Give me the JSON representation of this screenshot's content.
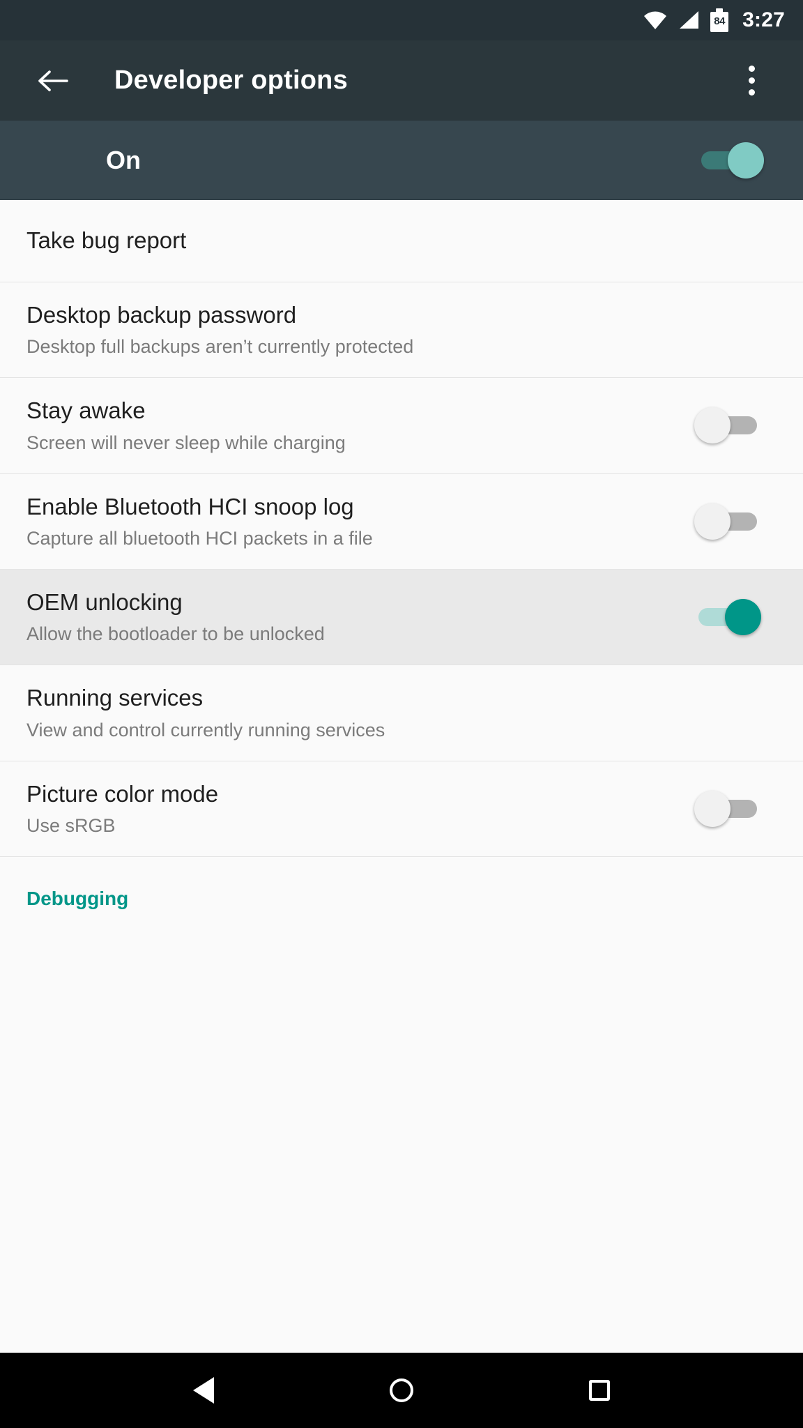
{
  "status_bar": {
    "wifi_icon": "wifi-icon",
    "signal_icon": "cell-signal-icon",
    "battery_icon": "battery-icon",
    "battery_level": "84",
    "time": "3:27"
  },
  "app_bar": {
    "back_icon": "back-arrow-icon",
    "title": "Developer options",
    "overflow_icon": "overflow-menu-icon"
  },
  "master_switch": {
    "label": "On",
    "state": "on"
  },
  "colors": {
    "accent": "#009688",
    "switch_thumb_on": "#80cbc4",
    "appbar_bg": "#2b373c",
    "band_bg": "#37474f",
    "statusbar_bg": "#263238",
    "list_bg": "#fafafa",
    "highlight_bg": "#e9e9e9"
  },
  "list": [
    {
      "title": "Take bug report",
      "subtitle": "",
      "has_switch": false,
      "switch_state": "",
      "highlighted": false
    },
    {
      "title": "Desktop backup password",
      "subtitle": "Desktop full backups aren’t currently protected",
      "has_switch": false,
      "switch_state": "",
      "highlighted": false
    },
    {
      "title": "Stay awake",
      "subtitle": "Screen will never sleep while charging",
      "has_switch": true,
      "switch_state": "off",
      "highlighted": false
    },
    {
      "title": "Enable Bluetooth HCI snoop log",
      "subtitle": "Capture all bluetooth HCI packets in a file",
      "has_switch": true,
      "switch_state": "off",
      "highlighted": false
    },
    {
      "title": "OEM unlocking",
      "subtitle": "Allow the bootloader to be unlocked",
      "has_switch": true,
      "switch_state": "on",
      "highlighted": true
    },
    {
      "title": "Running services",
      "subtitle": "View and control currently running services",
      "has_switch": false,
      "switch_state": "",
      "highlighted": false
    },
    {
      "title": "Picture color mode",
      "subtitle": "Use sRGB",
      "has_switch": true,
      "switch_state": "off",
      "highlighted": false
    }
  ],
  "section_header": {
    "label": "Debugging"
  },
  "nav_bar": {
    "back_icon": "nav-back-icon",
    "home_icon": "nav-home-icon",
    "recents_icon": "nav-recents-icon"
  }
}
